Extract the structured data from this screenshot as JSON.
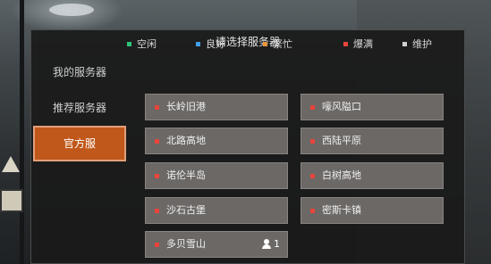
{
  "dialog": {
    "title": "请选择服务器"
  },
  "tabs": [
    {
      "label": "我的服务器",
      "active": false
    },
    {
      "label": "推荐服务器",
      "active": false
    },
    {
      "label": "官方服",
      "active": true
    }
  ],
  "legend": [
    {
      "label": "空闲",
      "color": "#2ec47a"
    },
    {
      "label": "良好",
      "color": "#3fa0e8"
    },
    {
      "label": "繁忙",
      "color": "#e8943a"
    },
    {
      "label": "爆满",
      "color": "#e8453b"
    },
    {
      "label": "维护",
      "color": "#cfcfcf"
    }
  ],
  "servers": [
    {
      "name": "长岭旧港",
      "status": "爆满"
    },
    {
      "name": "嚎风隘口",
      "status": "爆满"
    },
    {
      "name": "北路高地",
      "status": "爆满"
    },
    {
      "name": "西陆平原",
      "status": "爆满"
    },
    {
      "name": "诺伦半岛",
      "status": "爆满"
    },
    {
      "name": "白树高地",
      "status": "爆满"
    },
    {
      "name": "沙石古堡",
      "status": "爆满"
    },
    {
      "name": "密斯卡镇",
      "status": "爆满"
    },
    {
      "name": "多贝雪山",
      "status": "爆满",
      "players": "1"
    }
  ],
  "status_color": "#e8453b"
}
